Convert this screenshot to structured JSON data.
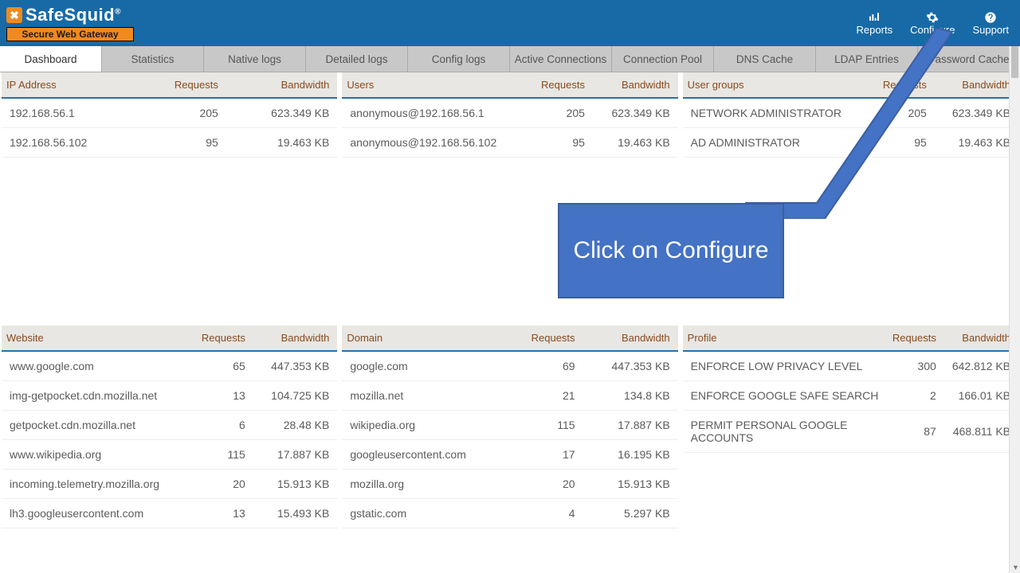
{
  "brand": {
    "name": "SafeSquid",
    "reg": "®",
    "tagline": "Secure Web Gateway"
  },
  "topnav": {
    "reports": "Reports",
    "configure": "Configure",
    "support": "Support"
  },
  "tabs": [
    "Dashboard",
    "Statistics",
    "Native logs",
    "Detailed logs",
    "Config logs",
    "Active Connections",
    "Connection Pool",
    "DNS Cache",
    "LDAP Entries",
    "Password Cache"
  ],
  "active_tab": 0,
  "columns": {
    "requests": "Requests",
    "bandwidth": "Bandwidth"
  },
  "panels": {
    "ip": {
      "title": "IP Address",
      "rows": [
        {
          "k": "192.168.56.1",
          "r": "205",
          "b": "623.349 KB"
        },
        {
          "k": "192.168.56.102",
          "r": "95",
          "b": "19.463 KB"
        }
      ]
    },
    "users": {
      "title": "Users",
      "rows": [
        {
          "k": "anonymous@192.168.56.1",
          "r": "205",
          "b": "623.349 KB"
        },
        {
          "k": "anonymous@192.168.56.102",
          "r": "95",
          "b": "19.463 KB"
        }
      ]
    },
    "usergroups": {
      "title": "User groups",
      "rows": [
        {
          "k": "NETWORK ADMINISTRATOR",
          "r": "205",
          "b": "623.349 KB"
        },
        {
          "k": "AD ADMINISTRATOR",
          "r": "95",
          "b": "19.463 KB"
        }
      ]
    },
    "website": {
      "title": "Website",
      "rows": [
        {
          "k": "www.google.com",
          "r": "65",
          "b": "447.353 KB"
        },
        {
          "k": "img-getpocket.cdn.mozilla.net",
          "r": "13",
          "b": "104.725 KB"
        },
        {
          "k": "getpocket.cdn.mozilla.net",
          "r": "6",
          "b": "28.48 KB"
        },
        {
          "k": "www.wikipedia.org",
          "r": "115",
          "b": "17.887 KB"
        },
        {
          "k": "incoming.telemetry.mozilla.org",
          "r": "20",
          "b": "15.913 KB"
        },
        {
          "k": "lh3.googleusercontent.com",
          "r": "13",
          "b": "15.493 KB"
        }
      ]
    },
    "domain": {
      "title": "Domain",
      "rows": [
        {
          "k": "google.com",
          "r": "69",
          "b": "447.353 KB"
        },
        {
          "k": "mozilla.net",
          "r": "21",
          "b": "134.8 KB"
        },
        {
          "k": "wikipedia.org",
          "r": "115",
          "b": "17.887 KB"
        },
        {
          "k": "googleusercontent.com",
          "r": "17",
          "b": "16.195 KB"
        },
        {
          "k": "mozilla.org",
          "r": "20",
          "b": "15.913 KB"
        },
        {
          "k": "gstatic.com",
          "r": "4",
          "b": "5.297 KB"
        }
      ]
    },
    "profile": {
      "title": "Profile",
      "rows": [
        {
          "k": "ENFORCE LOW PRIVACY LEVEL",
          "r": "300",
          "b": "642.812 KB"
        },
        {
          "k": "ENFORCE GOOGLE SAFE SEARCH",
          "r": "2",
          "b": "166.01 KB"
        },
        {
          "k": "PERMIT PERSONAL GOOGLE ACCOUNTS",
          "r": "87",
          "b": "468.811 KB"
        }
      ]
    }
  },
  "annotation": {
    "text": "Click on Configure"
  },
  "colors": {
    "topbar": "#176aa6",
    "accent": "#f08a1d",
    "callout": "#4472c4"
  }
}
